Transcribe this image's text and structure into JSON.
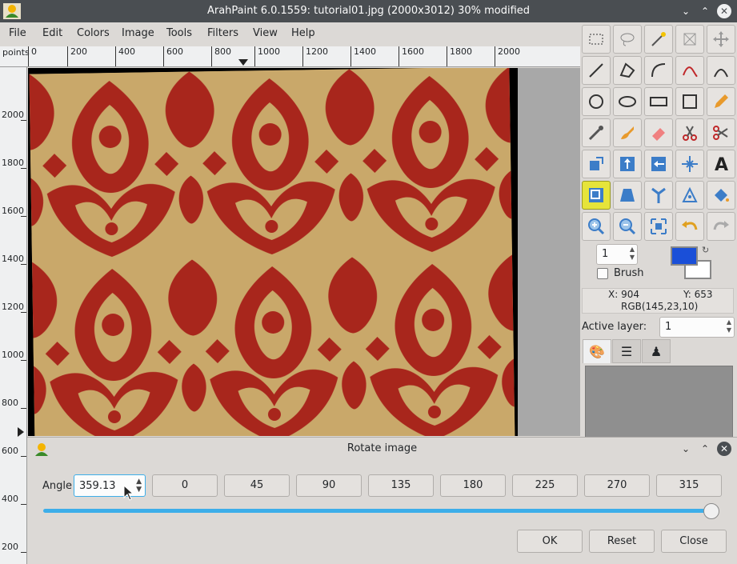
{
  "window": {
    "title": "ArahPaint 6.0.1559: tutorial01.jpg (2000x3012) 30% modified"
  },
  "menu": [
    "File",
    "Edit",
    "Colors",
    "Image",
    "Tools",
    "Filters",
    "View",
    "Help"
  ],
  "ruler": {
    "units": "points",
    "h_labels": [
      "0",
      "200",
      "400",
      "600",
      "800",
      "1000",
      "1200",
      "1400",
      "1600",
      "1800",
      "2000"
    ],
    "v_labels": [
      "2000",
      "1800",
      "1600",
      "1400",
      "1200",
      "1000",
      "800",
      "600",
      "400",
      "200"
    ]
  },
  "tools": [
    "rect-select-icon",
    "lasso-icon",
    "magic-wand-icon",
    "crop-icon",
    "move-icon",
    "line-icon",
    "polygon-icon",
    "curve-icon",
    "path-red-icon",
    "bezier-icon",
    "circle-icon",
    "ellipse-icon",
    "rectangle-icon",
    "square-icon",
    "pencil-icon",
    "eyedropper-icon",
    "brush-icon",
    "eraser-icon",
    "scissors-icon",
    "cut-icon",
    "clone-icon",
    "flip-vertical-icon",
    "flip-horizontal-icon",
    "center-icon",
    "text-icon",
    "resize-icon",
    "perspective-icon",
    "mirror-icon",
    "warp-icon",
    "fill-icon",
    "zoom-in-icon",
    "zoom-out-icon",
    "fit-icon",
    "undo-icon",
    "redo-icon"
  ],
  "brush": {
    "size": "1",
    "label": "Brush",
    "fg_color": "#1a4fd8",
    "bg_color": "#ffffff"
  },
  "status": {
    "x": "X: 904",
    "y": "Y: 653",
    "rgb": "RGB(145,23,10)"
  },
  "layer": {
    "label": "Active layer:",
    "value": "1"
  },
  "dialog": {
    "title": "Rotate image",
    "angle_label": "Angle",
    "angle_value": "359.13",
    "presets": [
      "0",
      "45",
      "90",
      "135",
      "180",
      "225",
      "270",
      "315"
    ],
    "slider_fraction": 0.9976,
    "ok": "OK",
    "reset": "Reset",
    "close": "Close"
  },
  "colors": {
    "titlebar": "#4a4e52",
    "accent": "#3daee9",
    "pattern_red": "#a8261c",
    "pattern_gold": "#c9a86a"
  }
}
